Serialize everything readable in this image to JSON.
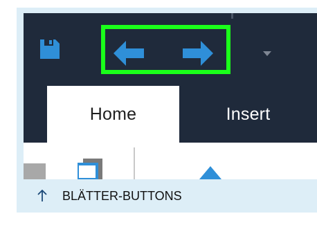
{
  "quick_access_toolbar": {
    "save_icon": "save-icon",
    "back_icon": "arrow-left-icon",
    "forward_icon": "arrow-right-icon",
    "customize_icon": "dropdown-arrow-icon"
  },
  "tabs": [
    {
      "label": "Home",
      "active": true
    },
    {
      "label": "Insert",
      "active": false
    }
  ],
  "caption": {
    "icon": "arrow-up-icon",
    "text": "BLÄTTER-BUTTONS"
  },
  "colors": {
    "titlebar": "#1f2a3b",
    "accent_blue": "#2f8fd8",
    "highlight": "#1aff1a",
    "caption_background": "#ddeef7",
    "active_tab": "#ffffff"
  }
}
